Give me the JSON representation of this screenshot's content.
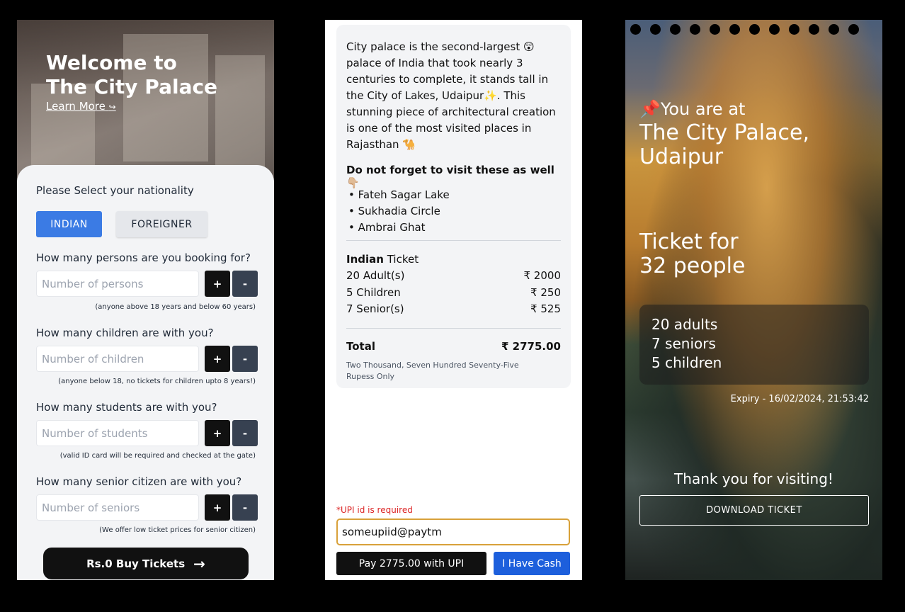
{
  "screen1": {
    "hero_title_line1": "Welcome to",
    "hero_title_line2": "The City Palace",
    "learn_more": "Learn More",
    "learn_more_icon": "↪",
    "nationality_label": "Please Select your nationality",
    "nationality_options": [
      "INDIAN",
      "FOREIGNER"
    ],
    "persons_question": "How many persons are you booking for?",
    "persons_placeholder": "Number of persons",
    "persons_hint": "(anyone above 18 years and below 60 years)",
    "children_question": "How many children are with you?",
    "children_placeholder": "Number of children",
    "children_hint": "(anyone below 18, no tickets for children upto 8 years!)",
    "students_question": "How many students are with you?",
    "students_placeholder": "Number of students",
    "students_hint": "(valid ID card will be required and checked at the gate)",
    "seniors_question": "How many senior citizen are with you?",
    "seniors_placeholder": "Number of seniors",
    "seniors_hint": "(We offer low ticket prices for senior citizen)",
    "plus": "+",
    "minus": "-",
    "buy_label": "Rs.0 Buy Tickets",
    "buy_icon": "→"
  },
  "screen2": {
    "paragraph": "City palace is the second-largest 😲 palace of India that took nearly 3 centuries to complete, it stands tall in the City of Lakes, Udaipur✨. This stunning piece of architectural creation is one of the most visited places in Rajasthan 🐪",
    "visit_heading": "Do not forget to visit these as well 👇🏼",
    "places": [
      "Fateh Sagar Lake",
      "Sukhadia Circle",
      "Ambrai Ghat"
    ],
    "ticket_type_bold": "Indian",
    "ticket_type_rest": " Ticket",
    "lines": [
      {
        "label": "20 Adult(s)",
        "amount": "₹ 2000"
      },
      {
        "label": "5 Children",
        "amount": "₹ 250"
      },
      {
        "label": "7 Senior(s)",
        "amount": "₹ 525"
      }
    ],
    "total_label": "Total",
    "total_amount": "₹ 2775.00",
    "total_words": "Two Thousand, Seven Hundred Seventy-Five Rupess Only",
    "upi_error": "*UPI id is required",
    "upi_value": "someupiid@paytm",
    "pay_label": "Pay 2775.00 with UPI",
    "cash_label": "I Have Cash"
  },
  "screen3": {
    "pin_icon": "📌",
    "you_are_at": "You are at",
    "palace_line1": "The City Palace,",
    "palace_line2": "Udaipur",
    "ticket_for_line1": "Ticket for",
    "ticket_for_line2": "32 people",
    "adults": "20 adults",
    "seniors": "7 seniors",
    "children": "5 children",
    "expiry": "Expiry - 16/02/2024, 21:53:42",
    "thanks": "Thank you for visiting!",
    "download_label": "DOWNLOAD TICKET"
  }
}
